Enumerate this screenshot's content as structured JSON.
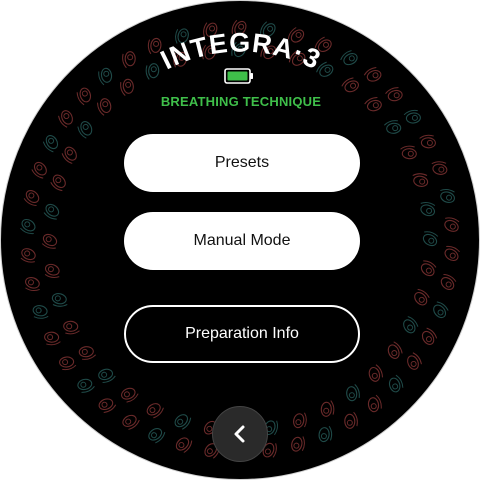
{
  "header": {
    "brand": "INTEGRA·3",
    "subtitle": "BREATHING TECHNIQUE",
    "battery_level": 1.0
  },
  "menu": {
    "presets_label": "Presets",
    "manual_mode_label": "Manual Mode",
    "preparation_info_label": "Preparation Info"
  },
  "navigation": {
    "back_icon": "chevron-left-icon"
  },
  "colors": {
    "background": "#000000",
    "accent_green": "#3fbf4a",
    "ring_red": "#6a2a2a",
    "ring_teal": "#1f4a48",
    "button_fill": "#ffffff",
    "back_button": "#2a2a2a"
  }
}
